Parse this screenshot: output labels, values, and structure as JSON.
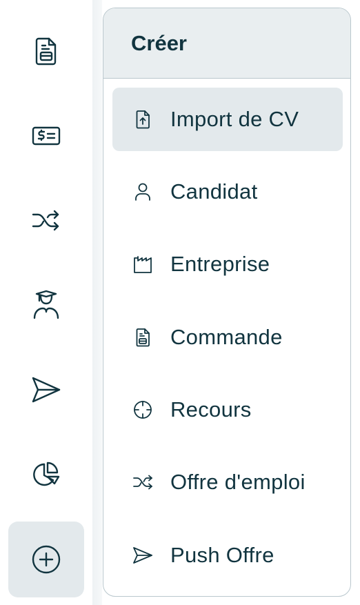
{
  "rail": {
    "items": [
      {
        "icon": "document-icon"
      },
      {
        "icon": "billing-icon"
      },
      {
        "icon": "shuffle-icon"
      },
      {
        "icon": "graduate-icon"
      },
      {
        "icon": "send-icon"
      },
      {
        "icon": "pie-chart-icon"
      },
      {
        "icon": "plus-circle-icon",
        "active": true
      }
    ]
  },
  "menu": {
    "title": "Créer",
    "items": [
      {
        "label": "Import de CV",
        "icon": "file-upload-icon",
        "active": true
      },
      {
        "label": "Candidat",
        "icon": "user-icon"
      },
      {
        "label": "Entreprise",
        "icon": "factory-icon"
      },
      {
        "label": "Commande",
        "icon": "document-icon"
      },
      {
        "label": "Recours",
        "icon": "crosshair-icon"
      },
      {
        "label": "Offre d'emploi",
        "icon": "shuffle-icon"
      },
      {
        "label": "Push Offre",
        "icon": "send-icon"
      }
    ]
  },
  "colors": {
    "text": "#11343f",
    "active_bg": "#e3e9ec",
    "header_bg": "#e9eef0",
    "border": "#b9c7cd"
  }
}
